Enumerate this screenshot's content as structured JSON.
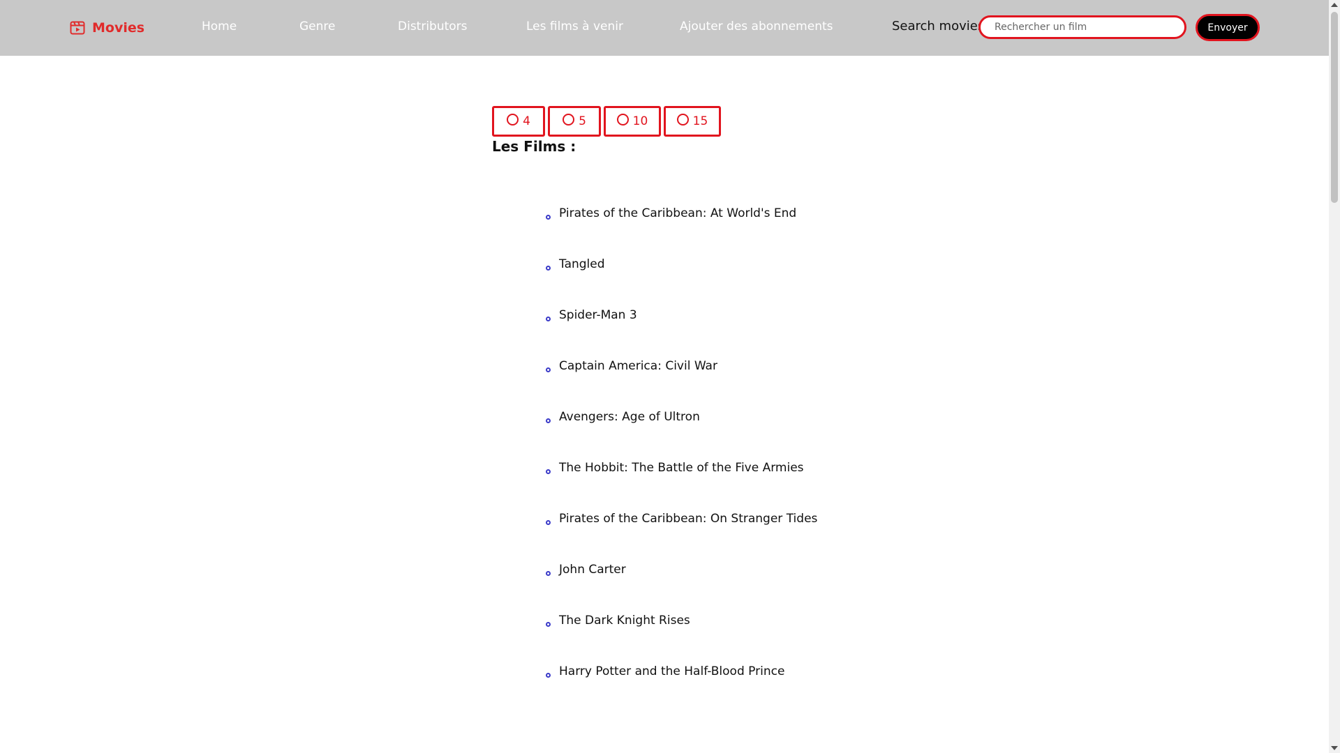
{
  "nav": {
    "brand": "Movies",
    "brand_icon": "film-icon",
    "links": [
      {
        "label": "Home"
      },
      {
        "label": "Genre"
      },
      {
        "label": "Distributors"
      },
      {
        "label": "Les films à venir"
      },
      {
        "label": "Ajouter des abonnements"
      }
    ],
    "search_label": "Search movies",
    "search_placeholder": "Rechercher un film",
    "search_value": "",
    "submit_label": "Envoyer"
  },
  "filters": {
    "options": [
      {
        "label": "4",
        "selected": false
      },
      {
        "label": "5",
        "selected": false
      },
      {
        "label": "10",
        "selected": false
      },
      {
        "label": "15",
        "selected": false
      }
    ]
  },
  "films": {
    "title": "Les Films :",
    "items": [
      {
        "title": "Pirates of the Caribbean: At World's End"
      },
      {
        "title": "Tangled"
      },
      {
        "title": "Spider-Man 3"
      },
      {
        "title": "Captain America: Civil War"
      },
      {
        "title": "Avengers: Age of Ultron"
      },
      {
        "title": "The Hobbit: The Battle of the Five Armies"
      },
      {
        "title": "Pirates of the Caribbean: On Stranger Tides"
      },
      {
        "title": "John Carter"
      },
      {
        "title": "The Dark Knight Rises"
      },
      {
        "title": "Harry Potter and the Half-Blood Prince"
      }
    ]
  },
  "colors": {
    "navbar": "#c8c8c8",
    "accent": "#e1141e",
    "bullet": "#3a3ac8"
  }
}
